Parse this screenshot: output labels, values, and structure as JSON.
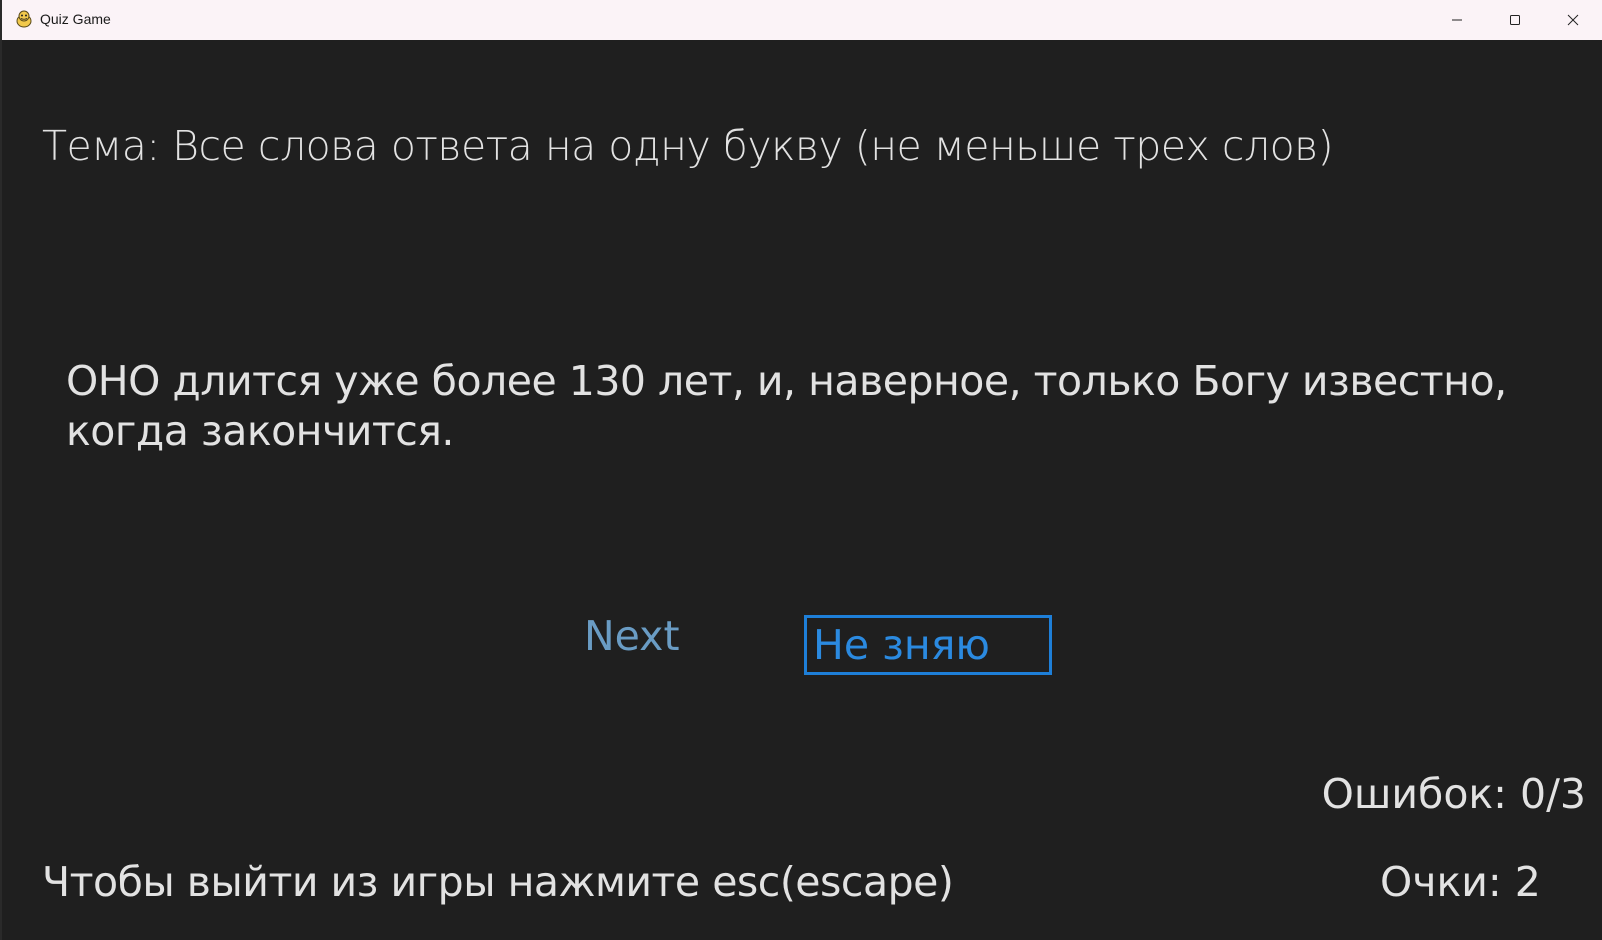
{
  "window": {
    "title": "Quiz Game",
    "icon": "python-snake-icon"
  },
  "quiz": {
    "theme": "Тема: Все слова ответа на одну букву (не меньше трех слов)",
    "question": "ОНО длится уже более 130 лет, и, наверное, только Богу известно, когда закончится.",
    "next_label": "Next",
    "dont_know_label": "Не зняю"
  },
  "status": {
    "errors": "Ошибок: 0/3",
    "score": "Очки: 2",
    "exit_hint": "Чтобы выйти из игры нажмите esc(escape)"
  },
  "colors": {
    "background": "#1f1f1f",
    "text": "#e2e2e2",
    "next_button": "#6a9cc4",
    "selected_button": "#1e7fd8",
    "titlebar": "#fbf3f7"
  }
}
